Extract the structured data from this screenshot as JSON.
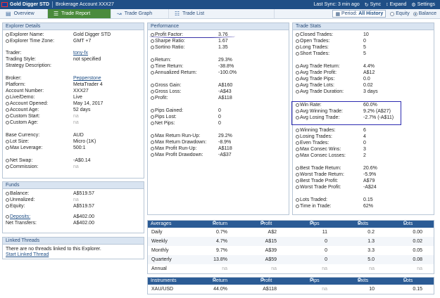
{
  "topbar": {
    "title": "Gold Digger STD",
    "account": "Brokerage Account XXX27",
    "last_sync": "Last Sync: 3 min ago",
    "sync_label": "Sync",
    "expand_label": "Expand",
    "settings_label": "Settings"
  },
  "tabs": [
    {
      "label": "Overview",
      "icon": "overview-icon"
    },
    {
      "label": "Trade Report",
      "icon": "report-icon"
    },
    {
      "label": "Trade Graph",
      "icon": "graph-icon"
    },
    {
      "label": "Trade List",
      "icon": "list-icon"
    }
  ],
  "period": {
    "label": "Period:",
    "value": "All History"
  },
  "radios": {
    "equity": "Equity",
    "balance": "Balance",
    "selected": "balance"
  },
  "explorer": {
    "title": "Explorer Details",
    "rows": [
      {
        "k": "Explorer Name:",
        "v": "Gold Digger STD"
      },
      {
        "k": "Explorer Time Zone:",
        "v": "GMT +7"
      },
      {
        "k": "Trader:",
        "v": "tony-fx"
      },
      {
        "k": "Trading Style:",
        "v": "not specified"
      },
      {
        "k": "Strategy Description:",
        "v": ""
      },
      {
        "k": "Broker:",
        "v": "Pepperstone"
      },
      {
        "k": "Platform:",
        "v": "MetaTrader 4"
      },
      {
        "k": "Account Number:",
        "v": "XXX27"
      },
      {
        "k": "Live/Demo:",
        "v": "Live"
      },
      {
        "k": "Account Opened:",
        "v": "May 14, 2017"
      },
      {
        "k": "Account Age:",
        "v": "52 days"
      },
      {
        "k": "Custom Start:",
        "v": "na"
      },
      {
        "k": "Custom Age:",
        "v": "na"
      },
      {
        "k": "Base Currency:",
        "v": "AUD"
      },
      {
        "k": "Lot Size:",
        "v": "Micro (1K)"
      },
      {
        "k": "Max Leverage:",
        "v": "500:1"
      },
      {
        "k": "Net Swap:",
        "v": "-A$0.14"
      },
      {
        "k": "Commission:",
        "v": "na"
      }
    ]
  },
  "funds": {
    "title": "Funds",
    "rows": [
      {
        "k": "Balance:",
        "v": "A$519.57"
      },
      {
        "k": "Unrealized:",
        "v": "na"
      },
      {
        "k": "Equity:",
        "v": "A$519.57"
      },
      {
        "k": "Deposits:",
        "v": "A$402.00"
      },
      {
        "k": "Net Transfers:",
        "v": "A$402.00"
      }
    ]
  },
  "linked": {
    "title": "Linked Threads",
    "message": "There are no threads linked to this Explorer.",
    "link": "Start Linked Thread"
  },
  "performance": {
    "title": "Performance",
    "rows": [
      {
        "k": "Profit Factor:",
        "v": "3.76"
      },
      {
        "k": "Sharpe Ratio:",
        "v": "1.67"
      },
      {
        "k": "Sortino Ratio:",
        "v": "1.35"
      },
      {
        "k": "Return:",
        "v": "29.3%"
      },
      {
        "k": "Time Return:",
        "v": "-38.8%"
      },
      {
        "k": "Annualized Return:",
        "v": "-100.0%"
      },
      {
        "k": "Gross Gain:",
        "v": "A$160"
      },
      {
        "k": "Gross Loss:",
        "v": "-A$43"
      },
      {
        "k": "Profit:",
        "v": "A$118"
      },
      {
        "k": "Pips Gained:",
        "v": "0"
      },
      {
        "k": "Pips Lost:",
        "v": "0"
      },
      {
        "k": "Net Pips:",
        "v": "0"
      },
      {
        "k": "Max Return Run-Up:",
        "v": "29.2%"
      },
      {
        "k": "Max Return Drawdown:",
        "v": "-8.9%"
      },
      {
        "k": "Max Profit Run-Up:",
        "v": "A$118"
      },
      {
        "k": "Max Profit Drawdown:",
        "v": "-A$37"
      }
    ]
  },
  "trade_stats": {
    "title": "Trade Stats",
    "rows": [
      {
        "k": "Closed Trades:",
        "v": "10"
      },
      {
        "k": "Open Trades:",
        "v": "0"
      },
      {
        "k": "Long Trades:",
        "v": "5"
      },
      {
        "k": "Short Trades:",
        "v": "5"
      },
      {
        "k": "Avg Trade Return:",
        "v": "4.4%"
      },
      {
        "k": "Avg Trade Profit:",
        "v": "A$12"
      },
      {
        "k": "Avg Trade Pips:",
        "v": "0.0"
      },
      {
        "k": "Avg Trade Lots:",
        "v": "0.02"
      },
      {
        "k": "Avg Trade Duration:",
        "v": "3 days"
      },
      {
        "k": "Win Rate:",
        "v": "60.0%"
      },
      {
        "k": "Avg Winning Trade:",
        "v": "9.2% (A$27)"
      },
      {
        "k": "Avg Losing Trade:",
        "v": "-2.7% (-A$11)"
      },
      {
        "k": "Winning Trades:",
        "v": "6"
      },
      {
        "k": "Losing Trades:",
        "v": "4"
      },
      {
        "k": "Even Trades:",
        "v": "0"
      },
      {
        "k": "Max Consec Wins:",
        "v": "3"
      },
      {
        "k": "Max Consec Losses:",
        "v": "2"
      },
      {
        "k": "Best Trade Return:",
        "v": "20.6%"
      },
      {
        "k": "Worst Trade Return:",
        "v": "-5.9%"
      },
      {
        "k": "Best Trade Profit:",
        "v": "A$79"
      },
      {
        "k": "Worst Trade Profit:",
        "v": "-A$24"
      },
      {
        "k": "Lots Traded:",
        "v": "0.15"
      },
      {
        "k": "Time in Trade:",
        "v": "62%"
      }
    ]
  },
  "averages": {
    "headers": [
      "Averages",
      "Return",
      "Profit",
      "Pips",
      "Exits",
      "Lots"
    ],
    "rows": [
      [
        "Daily",
        "0.7%",
        "A$2",
        "11",
        "0.2",
        "0.00"
      ],
      [
        "Weekly",
        "4.7%",
        "A$15",
        "0",
        "1.3",
        "0.02"
      ],
      [
        "Monthly",
        "9.7%",
        "A$39",
        "0",
        "3.3",
        "0.05"
      ],
      [
        "Quarterly",
        "13.8%",
        "A$59",
        "0",
        "5.0",
        "0.08"
      ],
      [
        "Annual",
        "na",
        "na",
        "na",
        "na",
        "na"
      ]
    ]
  },
  "instruments": {
    "headers": [
      "Instruments",
      "Return",
      "Profit",
      "Pips",
      "Exits",
      "Lots"
    ],
    "rows": [
      [
        "XAU/USD",
        "44.0%",
        "A$118",
        "na",
        "10",
        "0.15"
      ]
    ]
  }
}
